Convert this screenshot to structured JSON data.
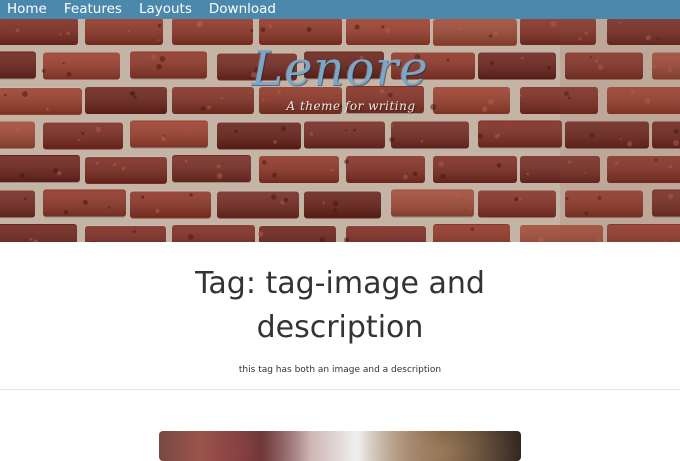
{
  "nav": {
    "items": [
      {
        "label": "Home"
      },
      {
        "label": "Features"
      },
      {
        "label": "Layouts"
      },
      {
        "label": "Download"
      }
    ]
  },
  "hero": {
    "site_title": "Lenore",
    "tagline": "A theme for writing"
  },
  "main": {
    "page_title": "Tag: tag-image and description",
    "tag_description": "this tag has both an image and a description"
  },
  "colors": {
    "nav_background": "#4a88ac",
    "nav_text": "#ffffff",
    "brand_title": "#7aa7c8",
    "heading_text": "#333333"
  },
  "icons": []
}
